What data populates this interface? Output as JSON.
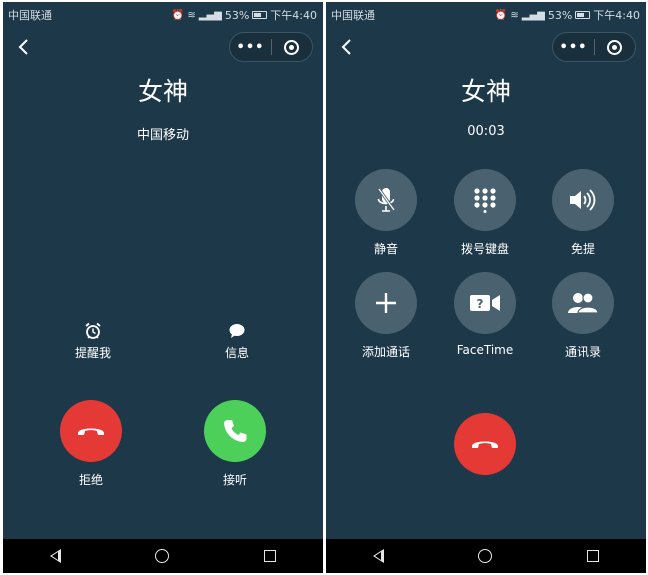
{
  "status_bar": {
    "carrier": "中国联通",
    "battery": "53%",
    "time": "下午4:40"
  },
  "capsule": {
    "more_label": "•••"
  },
  "incoming": {
    "caller_name": "女神",
    "carrier_label": "中国移动",
    "remind_label": "提醒我",
    "message_label": "信息",
    "decline_label": "拒绝",
    "answer_label": "接听"
  },
  "in_call": {
    "caller_name": "女神",
    "duration": "00:03",
    "buttons": [
      {
        "label": "静音",
        "icon": "mute-mic-icon"
      },
      {
        "label": "拨号键盘",
        "icon": "keypad-icon"
      },
      {
        "label": "免提",
        "icon": "speaker-icon"
      },
      {
        "label": "添加通话",
        "icon": "plus-icon"
      },
      {
        "label": "FaceTime",
        "icon": "facetime-icon"
      },
      {
        "label": "通讯录",
        "icon": "contacts-icon"
      }
    ]
  },
  "colors": {
    "background": "#1d3848",
    "decline": "#e53935",
    "answer": "#4cd05a",
    "control_button": "#4a6270"
  }
}
